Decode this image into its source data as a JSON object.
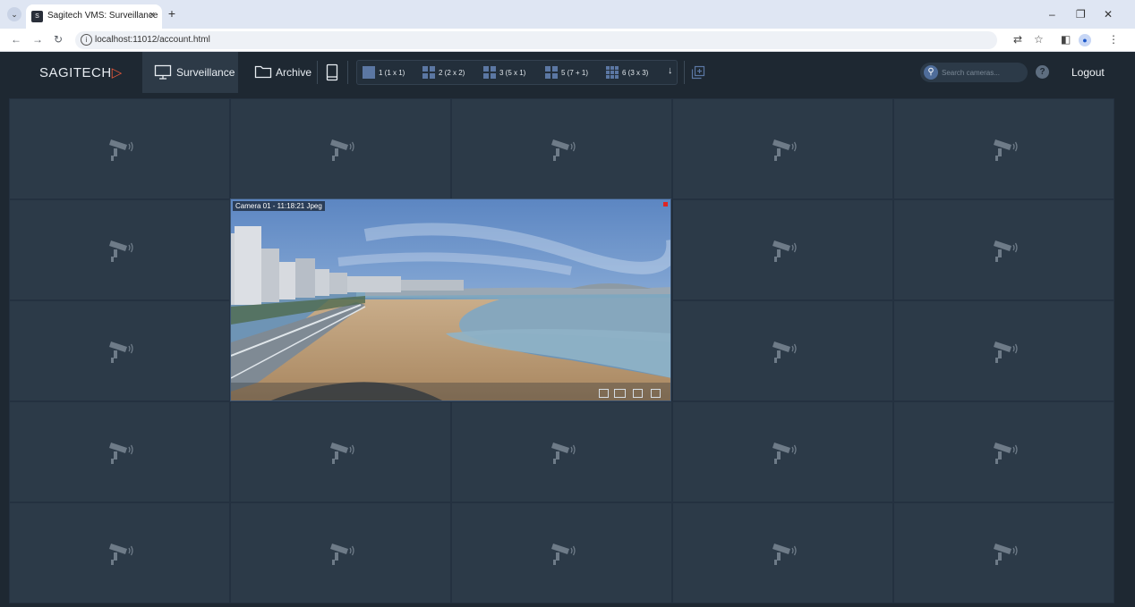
{
  "browser": {
    "tab_title": "Sagitech VMS: Surveillance",
    "tab_close": "×",
    "new_tab": "+",
    "favicon_text": "S",
    "url": "localhost:11012/account.html",
    "window_controls": {
      "minimize": "–",
      "restore": "❐",
      "close": "✕"
    }
  },
  "app": {
    "logo": {
      "text": "SAGITECH",
      "accent": "▷"
    },
    "nav": {
      "surveillance": "Surveillance",
      "archive": "Archive"
    },
    "layouts": [
      {
        "label": "1 (1 x 1)",
        "icon": "single-layout-icon"
      },
      {
        "label": "2 (2 x 2)",
        "icon": "grid-2x2-icon"
      },
      {
        "label": "3 (5 x 1)",
        "icon": "layout-5x1-icon"
      },
      {
        "label": "5 (7 + 1)",
        "icon": "layout-7plus1-icon"
      },
      {
        "label": "6 (3 x 3)",
        "icon": "grid-3x3-icon"
      }
    ],
    "layout_more": "↓",
    "search": {
      "placeholder": "Search cameras..."
    },
    "help": "?",
    "logout": "Logout"
  },
  "feed": {
    "label": "Camera 01 - 11:18:21 Jpeg",
    "tools": [
      "fullscreen-icon",
      "record-icon",
      "archive-icon",
      "download-icon"
    ]
  },
  "grid": {
    "rows": 5,
    "cols": 5,
    "empty_icon": "cctv-camera-icon"
  },
  "colors": {
    "accent": "#e8593a",
    "background": "#1e2832",
    "cell": "#2c3a48",
    "layout_icon": "#5b77a3",
    "recording": "#e02424"
  }
}
